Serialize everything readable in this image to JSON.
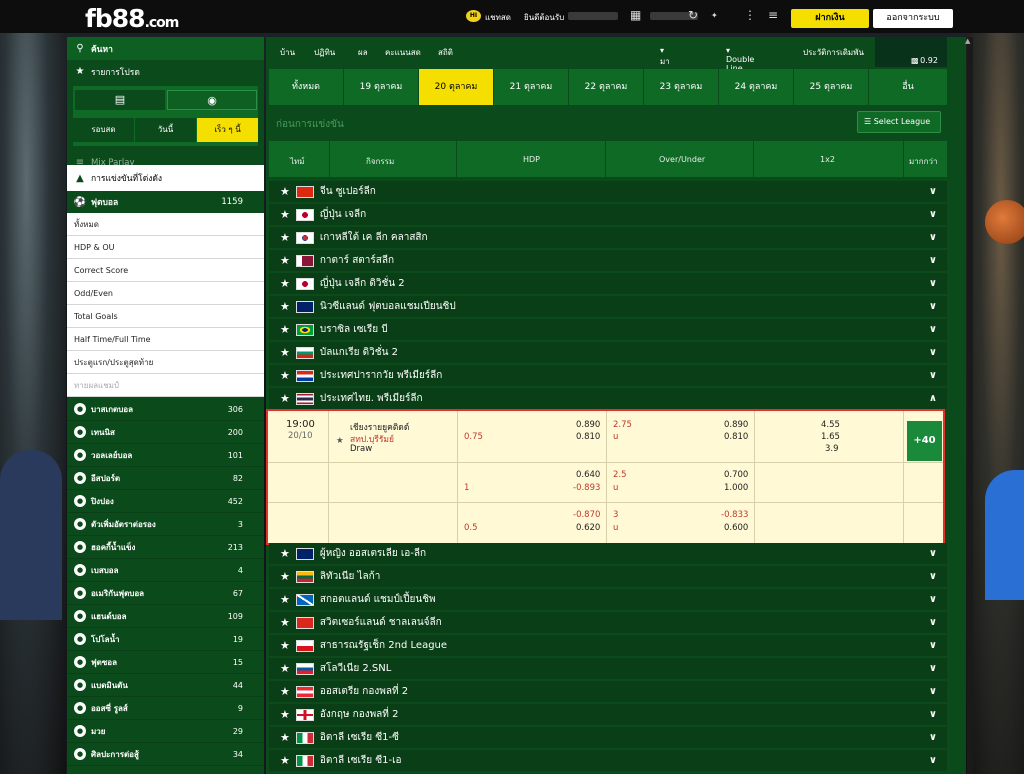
{
  "header": {
    "logo": "fb88",
    "logo_domain": ".com",
    "chat": "แชทสด",
    "welcome": "ยินดีต้อนรับ",
    "deposit": "ฝากเงิน",
    "logout": "ออกจากระบบ"
  },
  "sidebar": {
    "search": "ค้นหา",
    "promo": "รายการโปรด",
    "subtabs": [
      "รอบสด",
      "วันนี้",
      "เร็ว ๆ นี้"
    ],
    "mix_parlay": "Mix Parlay",
    "live_matches": "การแข่งขันที่โด่งดัง",
    "soccer": {
      "label": "ฟุตบอล",
      "count": "1159"
    },
    "soccer_subs": [
      "ทั้งหมด",
      "HDP & OU",
      "Correct Score",
      "Odd/Even",
      "Total Goals",
      "Half Time/Full Time",
      "ประตูแรก/ประตูสุดท้าย",
      "ทายผลแชมป์"
    ],
    "sports": [
      {
        "label": "บาสเกตบอล",
        "count": "306"
      },
      {
        "label": "เทนนิส",
        "count": "200"
      },
      {
        "label": "วอลเลย์บอล",
        "count": "101"
      },
      {
        "label": "อีสปอร์ต",
        "count": "82"
      },
      {
        "label": "ปิงปอง",
        "count": "452"
      },
      {
        "label": "ตัวเพิ่มอัตราต่อรอง",
        "count": "3"
      },
      {
        "label": "ฮอคกี้น้ำแข็ง",
        "count": "213"
      },
      {
        "label": "เบสบอล",
        "count": "4"
      },
      {
        "label": "อเมริกันฟุตบอล",
        "count": "67"
      },
      {
        "label": "แฮนด์บอล",
        "count": "109"
      },
      {
        "label": "โปโลน้ำ",
        "count": "19"
      },
      {
        "label": "ฟุตซอล",
        "count": "15"
      },
      {
        "label": "แบดมินตัน",
        "count": "44"
      },
      {
        "label": "ออสซี่ รูลส์",
        "count": "9"
      },
      {
        "label": "มวย",
        "count": "29"
      },
      {
        "label": "ศิลปะการต่อสู้",
        "count": "34"
      }
    ]
  },
  "main": {
    "nav": [
      "บ้าน",
      "ปฏิทิน",
      "ผล",
      "คะแนนสด",
      "สถิติ"
    ],
    "market": "มาเลย์",
    "line": "Double Line",
    "history": "ประวัติการเดิมพัน",
    "balance": "0.92 THB",
    "dates": [
      "ทั้งหมด",
      "19 ตุลาคม",
      "20 ตุลาคม",
      "21 ตุลาคม",
      "22 ตุลาคม",
      "23 ตุลาคม",
      "24 ตุลาคม",
      "25 ตุลาคม",
      "อื่น"
    ],
    "pre_match": "ก่อนการแข่งขัน",
    "select_league": "Select League",
    "columns": [
      "ไทม์",
      "กิจกรรม",
      "HDP",
      "Over/Under",
      "1x2",
      "มากกว่า"
    ],
    "leagues_top": [
      "จีน ซูเปอร์ลีก",
      "ญี่ปุ่น เจลีก",
      "เกาหลีใต้ เค ลีก คลาสสิก",
      "กาตาร์ สตาร์สลีก",
      "ญี่ปุ่น เจลีก ดิวิชั่น 2",
      "นิวซีแลนด์ ฟุตบอลแชมเปียนชิป",
      "บราซิล เซเรีย บี",
      "บัลแกเรีย ดิวิชั่น 2",
      "ประเทศปารากวัย พรีเมียร์ลีก",
      "ประเทศไทย. พรีเมียร์ลีก"
    ],
    "leagues_bottom": [
      "ผู้หญิง ออสเตรเลีย เอ-ลีก",
      "ลิทัวเนีย ไลก้า",
      "สกอตแลนด์ แชมป์เปี้ยนชิพ",
      "สวิตเซอร์แลนด์ ชาลเลนจ์ลีก",
      "สาธารณรัฐเช็ก 2nd League",
      "สโลวีเนีย 2.SNL",
      "ออสเตรีย กองพลที่ 2",
      "อังกฤษ กองพลที่ 2",
      "อิตาลี เซเรีย ซี1-ซี",
      "อิตาลี เซเรีย ซี1-เอ"
    ],
    "match": {
      "time": "19:00",
      "date": "20/10",
      "home": "เชียงรายยูคติดด์",
      "away": "สทป.บุรีรัมย์",
      "draw": "Draw",
      "more": "+40",
      "rows": [
        {
          "hdp_line": "0.75",
          "hdp_home": "0.890",
          "hdp_away": "0.810",
          "ou_line": "2.75",
          "ou_u": "u",
          "ou_over": "0.890",
          "ou_under": "0.810",
          "x1": "4.55",
          "x2": "1.65",
          "xd": "3.9"
        },
        {
          "hdp_line": "1",
          "hdp_home": "0.640",
          "hdp_away": "-0.893",
          "ou_line": "2.5",
          "ou_u": "u",
          "ou_over": "0.700",
          "ou_under": "1.000"
        },
        {
          "hdp_line": "0.5",
          "hdp_home": "-0.870",
          "hdp_away": "0.620",
          "ou_line": "3",
          "ou_u": "u",
          "ou_over": "-0.833",
          "ou_under": "0.600"
        }
      ]
    }
  },
  "colors": {
    "accent": "#f5df00",
    "sidebar": "#0b4a1a",
    "highlight": "#e0312a"
  }
}
